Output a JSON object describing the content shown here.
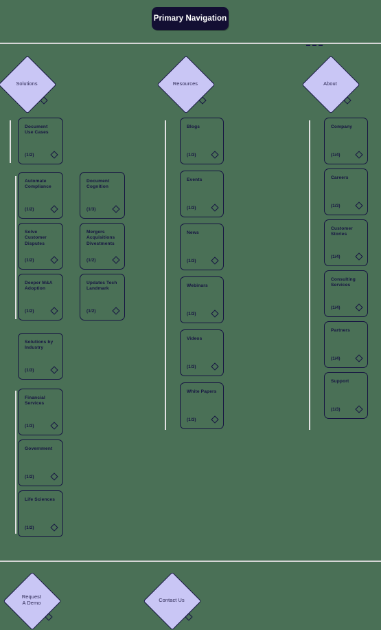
{
  "header": {
    "title": "Primary Navigation"
  },
  "columns": [
    {
      "id": "solutions",
      "diamond_label": "Solutions",
      "groups": [
        {
          "id": "solutions-top",
          "cards": [
            {
              "title": "Document Use Cases",
              "count": "(1/2)",
              "col": 0
            }
          ]
        },
        {
          "id": "solutions-usecases",
          "cards": [
            {
              "title": "Automate Compliance",
              "count": "(1/2)",
              "col": 0
            },
            {
              "title": "Document Cognition",
              "count": "(1/3)",
              "col": 1
            },
            {
              "title": "Solve Customer Disputes",
              "count": "(1/2)",
              "col": 0
            },
            {
              "title": "Mergers Acquisitions Divestments",
              "count": "(1/2)",
              "col": 1
            },
            {
              "title": "Deeper M&A Adoption",
              "count": "(1/2)",
              "col": 0
            },
            {
              "title": "Updates Tech Landmark",
              "count": "(1/2)",
              "col": 1
            }
          ]
        },
        {
          "id": "solutions-industry-root",
          "cards": [
            {
              "title": "Solutions by Industry",
              "count": "(1/3)",
              "col": 0
            }
          ]
        },
        {
          "id": "solutions-industry",
          "cards": [
            {
              "title": "Financial Services",
              "count": "(1/3)",
              "col": 0
            },
            {
              "title": "Government",
              "count": "(1/2)",
              "col": 0
            },
            {
              "title": "Life Sciences",
              "count": "(1/2)",
              "col": 0
            }
          ]
        }
      ]
    },
    {
      "id": "resources",
      "diamond_label": "Resources",
      "groups": [
        {
          "id": "resources-list",
          "cards": [
            {
              "title": "Blogs",
              "count": "(1/3)",
              "col": 0
            },
            {
              "title": "Events",
              "count": "(1/3)",
              "col": 0
            },
            {
              "title": "News",
              "count": "(1/3)",
              "col": 0
            },
            {
              "title": "Webinars",
              "count": "(1/3)",
              "col": 0
            },
            {
              "title": "Videos",
              "count": "(1/3)",
              "col": 0
            },
            {
              "title": "White Papers",
              "count": "(1/3)",
              "col": 0
            }
          ]
        }
      ]
    },
    {
      "id": "about",
      "diamond_label": "About",
      "groups": [
        {
          "id": "about-list",
          "cards": [
            {
              "title": "Company",
              "count": "(1/4)",
              "col": 0
            },
            {
              "title": "Careers",
              "count": "(1/3)",
              "col": 0
            },
            {
              "title": "Customer Stories",
              "count": "(1/4)",
              "col": 0
            },
            {
              "title": "Consulting Services",
              "count": "(1/4)",
              "col": 0
            },
            {
              "title": "Partners",
              "count": "(1/4)",
              "col": 0
            },
            {
              "title": "Support",
              "count": "(1/3)",
              "col": 0
            }
          ]
        }
      ]
    }
  ],
  "cta": [
    {
      "id": "request-a-demo",
      "label": "Request\nA Demo"
    },
    {
      "id": "contact-us",
      "label": "Contact Us"
    }
  ],
  "colors": {
    "background": "#4a7056",
    "diamond_fill": "#c9c6f5",
    "stroke": "#161342",
    "header_fill": "#130f33",
    "header_text": "#ffffff",
    "rule": "#d6d6d6"
  }
}
